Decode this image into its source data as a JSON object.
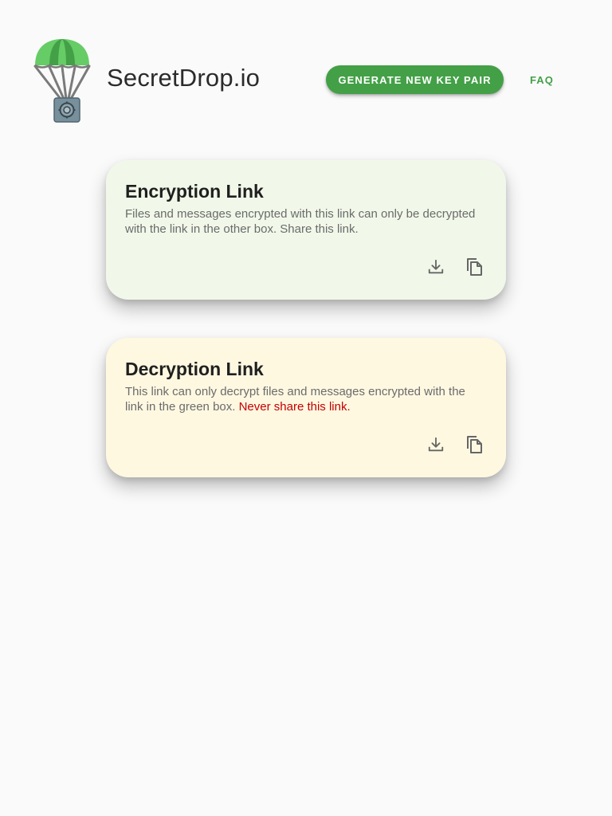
{
  "header": {
    "brand": "SecretDrop.io",
    "generate_button": "GENERATE NEW KEY PAIR",
    "faq_button": "FAQ"
  },
  "cards": {
    "encryption": {
      "title": "Encryption Link",
      "description": "Files and messages encrypted with this link can only be decrypted with the link in the other box. Share this link.",
      "background": "#f1f8e9",
      "icons": [
        "download-icon",
        "copy-icon"
      ]
    },
    "decryption": {
      "title": "Decryption Link",
      "description": "This link can only decrypt files and messages encrypted with the link in the green box.",
      "warning": "Never share this link.",
      "warning_color": "#c40000",
      "background": "#fff8e1",
      "icons": [
        "download-icon",
        "copy-icon"
      ]
    }
  },
  "colors": {
    "accent": "#43a047",
    "page_background": "#fafafa"
  }
}
